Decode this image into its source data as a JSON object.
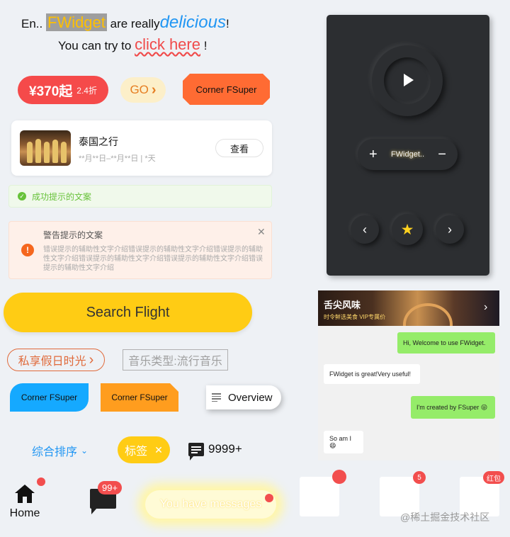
{
  "rich_text": {
    "line1_prefix": "En..",
    "line1_highlight": "FWidget",
    "line1_middle": "are really",
    "line1_italic": "delicious",
    "line1_suffix": "!",
    "line2_prefix": "You can try to",
    "line2_link": "click here",
    "line2_suffix": "!"
  },
  "price_tag": {
    "amount": "¥370起",
    "discount": "2.4折"
  },
  "go_button": {
    "label": "GO"
  },
  "corner_orange_red": {
    "label": "Corner FSuper"
  },
  "trip_card": {
    "title": "泰国之行",
    "subtitle": "**月**日–**月**日 | *天",
    "view_label": "查看"
  },
  "success_alert": {
    "text": "成功提示的文案"
  },
  "warning_alert": {
    "title": "警告提示的文案",
    "description": "错误提示的辅助性文字介绍错误提示的辅助性文字介绍错误提示的辅助性文字介绍错误提示的辅助性文字介绍错误提示的辅助性文字介绍错误提示的辅助性文字介绍"
  },
  "search_button": {
    "label": "Search Flight"
  },
  "private_holiday": {
    "label": "私享假日时光"
  },
  "music_type": {
    "label": "音乐类型:流行音乐"
  },
  "corner_blue": {
    "label": "Corner FSuper"
  },
  "corner_orange": {
    "label": "Corner FSuper"
  },
  "overview_button": {
    "label": "Overview"
  },
  "sort": {
    "label": "综合排序"
  },
  "tag_chip": {
    "label": "标签"
  },
  "message_count": {
    "value": "9999+"
  },
  "bottom_nav": {
    "home_label": "Home",
    "chat_badge": "99+",
    "you_have_messages": "You have messages"
  },
  "player": {
    "volume_label": "FWidget.."
  },
  "banner": {
    "title": "舌尖风味",
    "subtitle": "时令鲜选美食 VIP专属价"
  },
  "chat_messages": [
    {
      "side": "right",
      "text": "Hi, Welcome to use FWidget."
    },
    {
      "side": "left",
      "text": "FWidget is great!Very useful!"
    },
    {
      "side": "right",
      "text": "I'm created by FSuper 😜"
    },
    {
      "side": "left",
      "text": "So am I 😄"
    }
  ],
  "badge_squares": {
    "second_badge": "5",
    "third_badge": "红包"
  },
  "watermark": "@稀土掘金技术社区",
  "colors": {
    "accent_yellow": "#ffcc14",
    "price_red": "#f54a4a",
    "corner_orange_red": "#ff6b33",
    "corner_blue": "#15a9ff",
    "corner_orange": "#ff9d1e",
    "player_bg": "#2c2e31",
    "chat_green": "#95ec69",
    "badge_red": "#f24e4e"
  }
}
